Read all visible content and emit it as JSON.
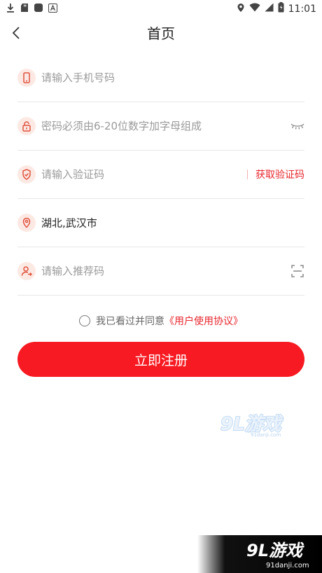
{
  "status_bar": {
    "time": "11:01"
  },
  "nav": {
    "title": "首页"
  },
  "form": {
    "phone": {
      "placeholder": "请输入手机号码"
    },
    "password": {
      "placeholder": "密码必须由6-20位数字加字母组成"
    },
    "verify": {
      "placeholder": "请输入验证码",
      "get_code_label": "获取验证码"
    },
    "location": {
      "value": "湖北,武汉市"
    },
    "referral": {
      "placeholder": "请输入推荐码"
    }
  },
  "agreement": {
    "prefix": "我已看过并同意",
    "link": "《用户使用协议》"
  },
  "submit_label": "立即注册",
  "watermark": {
    "logo": "9L游戏",
    "site": "91danji.com"
  },
  "colors": {
    "accent": "#f81a22",
    "link": "#e8262d",
    "icon_bg": "#fde9e4",
    "icon_stroke": "#e0523e"
  }
}
